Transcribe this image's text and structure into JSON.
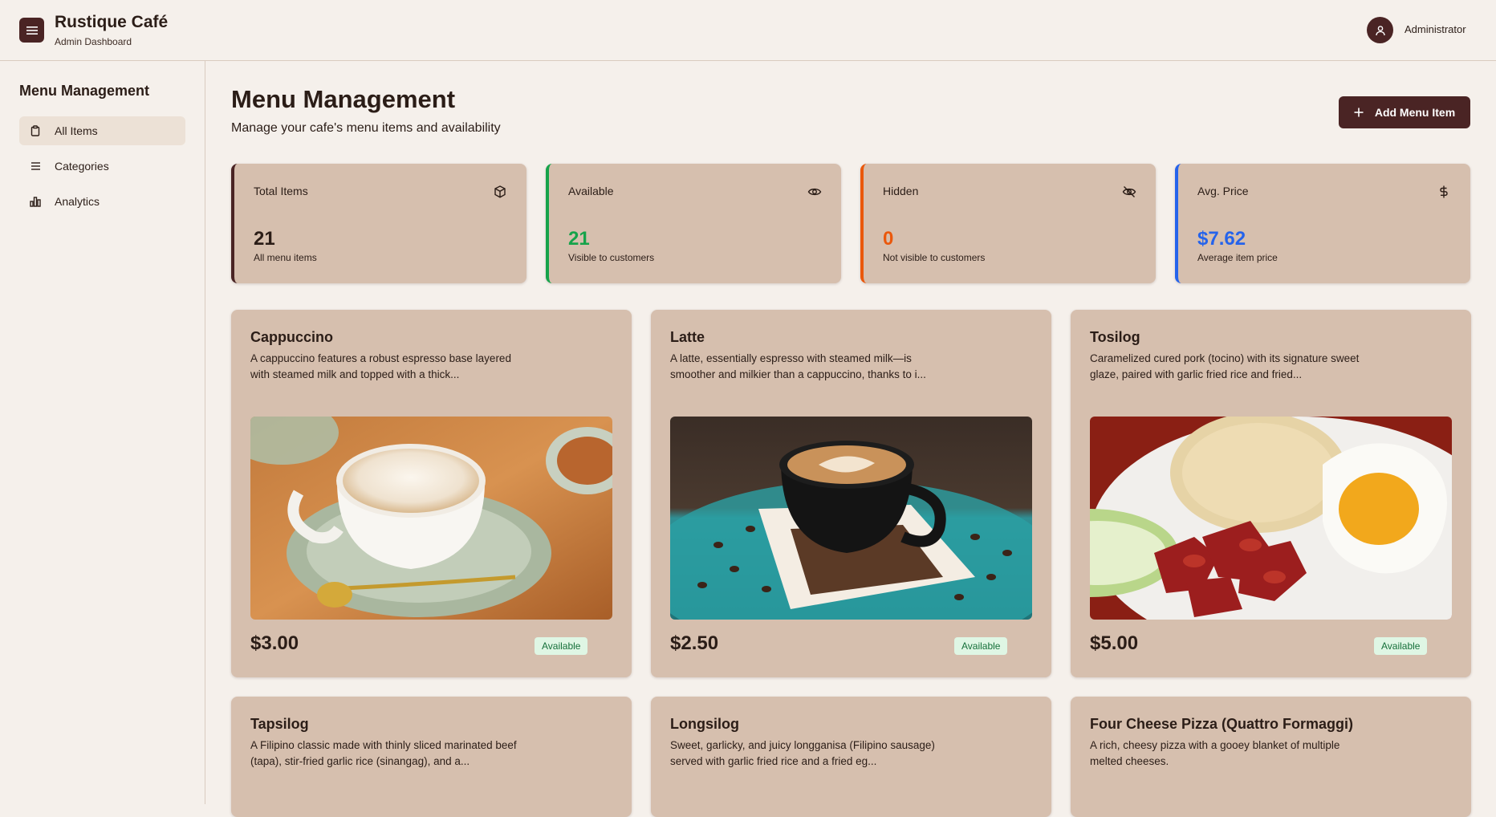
{
  "app": {
    "name": "Rustique Café",
    "subtitle": "Admin Dashboard"
  },
  "user": {
    "name": "Administrator"
  },
  "sidebar": {
    "title": "Menu Management",
    "items": [
      {
        "label": "All Items",
        "icon": "clipboard-icon",
        "active": true
      },
      {
        "label": "Categories",
        "icon": "list-icon",
        "active": false
      },
      {
        "label": "Analytics",
        "icon": "bar-chart-icon",
        "active": false
      }
    ]
  },
  "main": {
    "title": "Menu Management",
    "subtitle": "Manage your cafe's menu items and availability",
    "add_button": "Add Menu Item"
  },
  "stats": [
    {
      "label": "Total Items",
      "value": "21",
      "note": "All menu items",
      "icon": "box-icon",
      "color": "#4a2424"
    },
    {
      "label": "Available",
      "value": "21",
      "note": "Visible to customers",
      "icon": "eye-icon",
      "color": "#16a34a"
    },
    {
      "label": "Hidden",
      "value": "0",
      "note": "Not visible to customers",
      "icon": "eye-off-icon",
      "color": "#ea580c"
    },
    {
      "label": "Avg. Price",
      "value": "$7.62",
      "note": "Average item price",
      "icon": "dollar-icon",
      "color": "#2563eb"
    }
  ],
  "items": [
    {
      "name": "Cappuccino",
      "desc": "A cappuccino features a robust espresso base layered with steamed milk and topped with a thick...",
      "price": "$3.00",
      "status": "Available"
    },
    {
      "name": "Latte",
      "desc": "A latte, essentially espresso with steamed milk—is smoother and milkier than a cappuccino, thanks to i...",
      "price": "$2.50",
      "status": "Available"
    },
    {
      "name": "Tosilog",
      "desc": "Caramelized cured pork (tocino) with its signature sweet glaze, paired with garlic fried rice and fried...",
      "price": "$5.00",
      "status": "Available"
    },
    {
      "name": "Tapsilog",
      "desc": "A Filipino classic made with thinly sliced marinated beef (tapa), stir-fried garlic rice (sinangag), and a..."
    },
    {
      "name": "Longsilog",
      "desc": "Sweet, garlicky, and juicy longganisa (Filipino sausage) served with garlic fried rice and a fried eg..."
    },
    {
      "name": "Four Cheese Pizza (Quattro Formaggi)",
      "desc": "A rich, cheesy pizza with a gooey blanket of multiple melted cheeses."
    }
  ]
}
